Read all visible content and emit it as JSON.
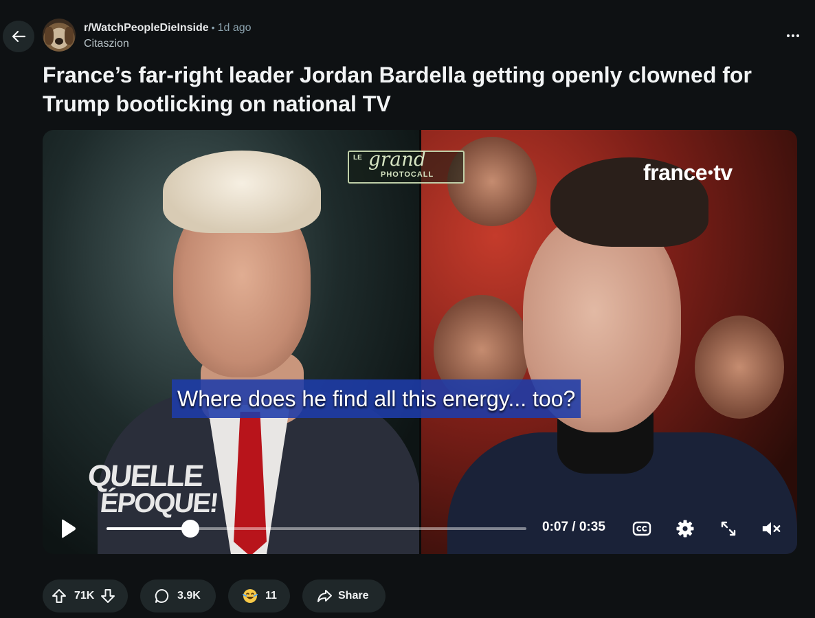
{
  "post": {
    "subreddit": "r/WatchPeopleDieInside",
    "separator": "•",
    "time_ago": "1d ago",
    "author": "Citaszion",
    "title": "France’s far-right leader Jordan Bardella getting openly clowned for Trump bootlicking on national TV"
  },
  "video": {
    "subtitle": "Where does he find all this energy... too?",
    "time_display": "0:07 / 0:35",
    "progress": 0.2,
    "logos": {
      "top_center_prefix": "LE",
      "top_center_main": "grand",
      "top_center_sub": "PHOTOCALL",
      "top_right_left": "france",
      "top_right_dot": "•",
      "top_right_right": "tv",
      "bottom_left_line1": "QUELLE",
      "bottom_left_line2": "ÉPOQUE!"
    }
  },
  "actions": {
    "votes": "71K",
    "comments": "3.9K",
    "awards": "11",
    "share_label": "Share"
  },
  "icons": {
    "back": "arrow-left-icon",
    "more": "ellipsis-icon",
    "play": "play-icon",
    "captions": "closed-captions-icon",
    "settings": "gear-icon",
    "fullscreen": "expand-icon",
    "mute": "speaker-muted-icon",
    "upvote": "arrow-up-icon",
    "downvote": "arrow-down-icon",
    "comment": "speech-bubble-icon",
    "award": "award-emoji-icon",
    "share": "share-arrow-icon"
  },
  "colors": {
    "background": "#0e1113",
    "pill": "#1f2729",
    "subtitle_bg": "#1e3caa",
    "muted_text": "#8ba2ad"
  }
}
